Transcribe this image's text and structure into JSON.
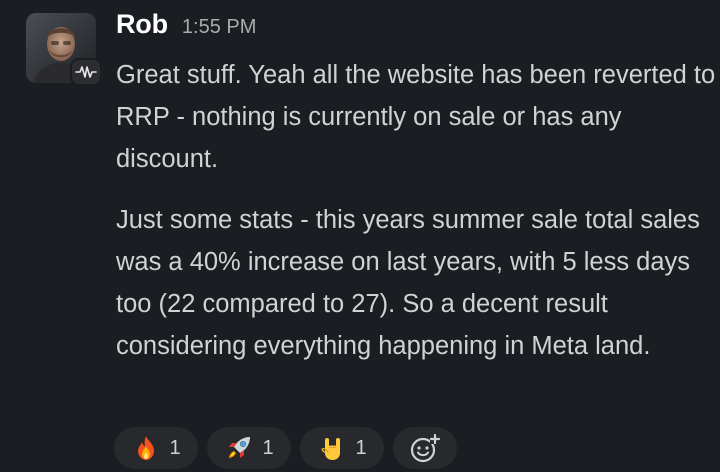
{
  "message": {
    "sender": "Rob",
    "timestamp": "1:55 PM",
    "paragraphs": [
      "Great stuff. Yeah all the website has been reverted to RRP - nothing is currently on sale or has any discount.",
      "Just some stats - this years summer sale total sales was a 40% increase on last years, with 5 less days too (22 compared to 27). So a decent result considering everything happening in Meta land."
    ]
  },
  "reactions": [
    {
      "emoji": "fire-icon",
      "count": "1"
    },
    {
      "emoji": "rocket-icon",
      "count": "1"
    },
    {
      "emoji": "rock-on-hand-icon",
      "count": "1"
    }
  ],
  "colors": {
    "background": "#1a1d21",
    "text": "#d1d2d3",
    "name": "#ffffff",
    "timestamp": "#ababad",
    "pill": "#27292d"
  }
}
